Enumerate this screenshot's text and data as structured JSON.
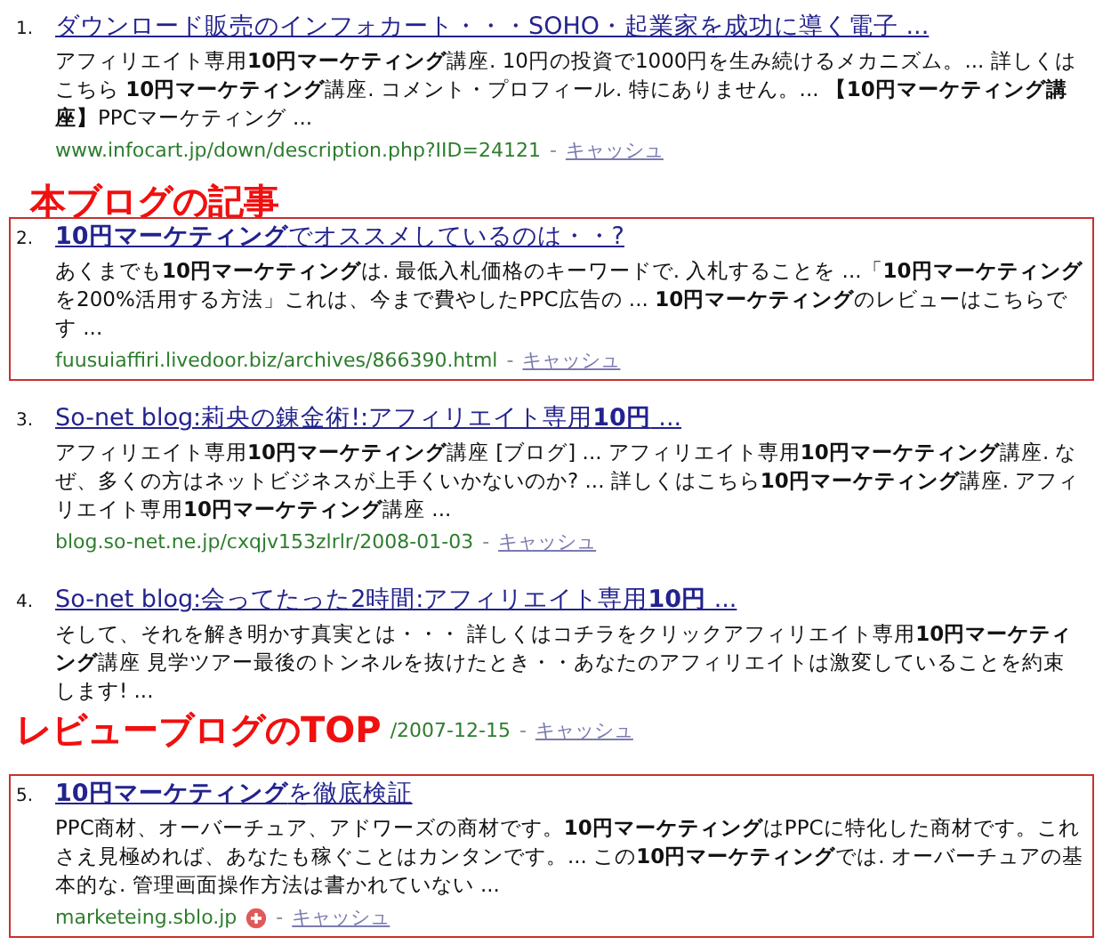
{
  "results": [
    {
      "number": "1.",
      "title": "ダウンロード販売のインフォカート・・・SOHO・起業家を成功に導く電子 ...",
      "snippet": "アフィリエイト専用**10円マーケティング**講座. 10円の投資で1000円を生み続けるメカニズム。... 詳しくはこちら **10円マーケティング**講座. コメント・プロフィール. 特にありません。... **【10円マーケティング講座】**PPCマーケティング ...",
      "url": "www.infocart.jp/down/description.php?IID=24121",
      "separator": "-",
      "cache": "キャッシュ",
      "boxed": false
    },
    {
      "number": "2.",
      "label_above": "本ブログの記事",
      "title": "**10円マーケティング**でオススメしているのは・・?",
      "snippet": "あくまでも**10円マーケティング**は. 最低入札価格のキーワードで. 入札することを ...「**10円マーケティング**を200%活用する方法」これは、今まで費やしたPPC広告の ... **10円マーケティング**のレビューはこちらです ...",
      "url": "fuusuiaffiri.livedoor.biz/archives/866390.html",
      "separator": "-",
      "cache": "キャッシュ",
      "boxed": true
    },
    {
      "number": "3.",
      "title": "So-net blog:莉央の錬金術!:アフィリエイト専用**10円** ...",
      "snippet": "アフィリエイト専用**10円マーケティング**講座 [ブログ] ... アフィリエイト専用**10円マーケティング**講座. なぜ、多くの方はネットビジネスが上手くいかないのか? ... 詳しくはこちら**10円マーケティング**講座. アフィリエイト専用**10円マーケティング**講座 ...",
      "url": "blog.so-net.ne.jp/cxqjv153zlrlr/2008-01-03",
      "separator": "-",
      "cache": "キャッシュ",
      "boxed": false
    },
    {
      "number": "4.",
      "title": "So-net blog:会ってたった2時間:アフィリエイト専用**10円** ...",
      "snippet": "そして、それを解き明かす真実とは・・・ 詳しくはコチラをクリックアフィリエイト専用**10円マーケティング**講座 見学ツアー最後のトンネルを抜けたとき・・あなたのアフィリエイトは激変していることを約束します! ...",
      "url_annotation": "レビューブログのTOP",
      "url": "/2007-12-15",
      "separator": "-",
      "cache": "キャッシュ",
      "boxed": false
    },
    {
      "number": "5.",
      "title": "**10円マーケティング**を徹底検証",
      "snippet": "PPC商材、オーバーチュア、アドワーズの商材です。**10円マーケティング**はPPCに特化した商材です。これさえ見極めれば、あなたも稼ぐことはカンタンです。... この**10円マーケティング**では. オーバーチュアの基本的な. 管理画面操作方法は書かれていない ...",
      "url": "marketeing.sblo.jp",
      "add_icon": true,
      "separator": "-",
      "cache": "キャッシュ",
      "boxed": true
    }
  ]
}
